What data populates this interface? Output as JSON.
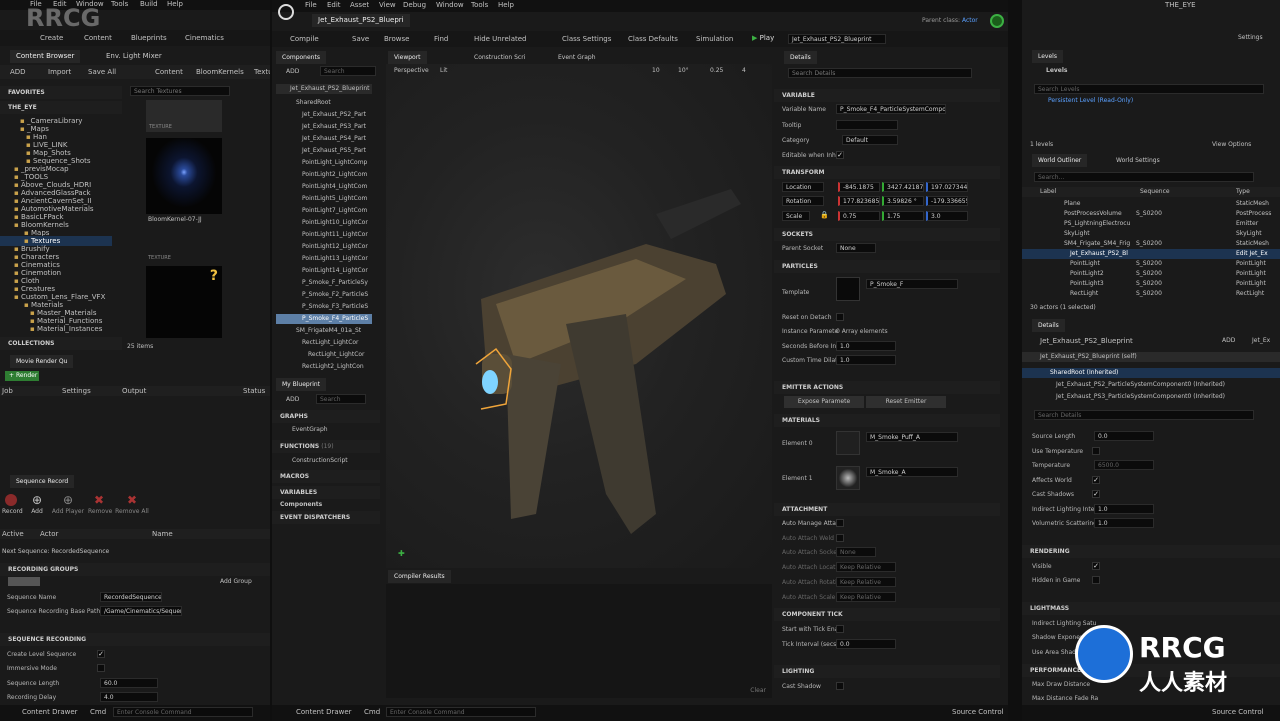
{
  "left": {
    "menu": [
      "File",
      "Edit",
      "Window",
      "Tools",
      "Build",
      "Help"
    ],
    "toolbar": [
      "Create",
      "Content",
      "Blueprints",
      "Cinematics"
    ],
    "tabs": [
      "Content Browser",
      "Env. Light Mixer"
    ],
    "cb_bar": {
      "add": "ADD",
      "import": "Import",
      "save_all": "Save All",
      "path": [
        "Content",
        "BloomKernels",
        "Textu"
      ]
    },
    "favorites": "FAVORITES",
    "project": "THE_EYE",
    "tree": [
      "_CameraLibrary",
      "_Maps",
      "Han",
      "LIVE_LINK",
      "Map_Shots",
      "Sequence_Shots",
      "_previsMocap",
      "_TOOLS",
      "Above_Clouds_HDRI",
      "AdvancedGlassPack",
      "AncientCavernSet_II",
      "AutomotiveMaterials",
      "BasicLFPack",
      "BloomKernels",
      "Maps",
      "Textures",
      "Brushify",
      "Characters",
      "Cinematics",
      "Cinemotion",
      "Cloth",
      "Creatures",
      "Custom_Lens_Flare_VFX",
      "Materials",
      "Master_Materials",
      "Material_Functions",
      "Material_Instances"
    ],
    "search_textures": "Search Textures",
    "asset_label1": "TEXTURE",
    "asset_name": "BloomKernel-07-JJ",
    "asset_label2": "TEXTURE",
    "question": "?",
    "collections": "COLLECTIONS",
    "items": "25 items",
    "mrq_tab": "Movie Render Qu",
    "render": "Render",
    "cols": [
      "Job",
      "Settings",
      "Output",
      "Status"
    ],
    "seq_tab": "Sequence Record",
    "seq_btns": [
      "Record",
      "Add",
      "Add Player",
      "Remove",
      "Remove All"
    ],
    "seq_cols": [
      "Active",
      "Actor",
      "Name"
    ],
    "next_seq": "Next Sequence: RecordedSequence",
    "recording_groups": "RECORDING GROUPS",
    "add_group": "Add Group",
    "seq_name_label": "Sequence Name",
    "seq_name": "RecordedSequence",
    "base_path_label": "Sequence Recording Base Path",
    "base_path": "/Game/Cinematics/Sequences",
    "seq_recording": "SEQUENCE RECORDING",
    "create_level": "Create Level Sequence",
    "immersive": "Immersive Mode",
    "seq_len_label": "Sequence Length",
    "seq_len": "60.0",
    "rec_delay_label": "Recording Delay",
    "rec_delay": "4.0",
    "drawer": "Content Drawer",
    "cmd": "Cmd",
    "console": "Enter Console Command"
  },
  "mid": {
    "menu": [
      "File",
      "Edit",
      "Asset",
      "View",
      "Debug",
      "Window",
      "Tools",
      "Help"
    ],
    "doc_tab": "Jet_Exhaust_PS2_Bluepri",
    "parent_label": "Parent class:",
    "parent": "Actor",
    "toolbar": [
      "Compile",
      "Save",
      "Browse",
      "Find",
      "Hide Unrelated",
      "Class Settings",
      "Class Defaults",
      "Simulation",
      "Play"
    ],
    "bp_select": "Jet_Exhaust_PS2_Blueprint",
    "components_tab": "Components",
    "add": "ADD",
    "search": "Search",
    "root_item": "Jet_Exhaust_PS2_Blueprint",
    "components": [
      "SharedRoot",
      "Jet_Exhaust_PS2_Part",
      "Jet_Exhaust_PS3_Part",
      "Jet_Exhaust_PS4_Part",
      "Jet_Exhaust_PS5_Part",
      "PointLight_LightComp",
      "PointLight2_LightCom",
      "PointLight4_LightCom",
      "PointLight5_LightCom",
      "PointLight7_LightCom",
      "PointLight10_LightCor",
      "PointLight11_LightCor",
      "PointLight12_LightCor",
      "PointLight13_LightCor",
      "PointLight14_LightCor",
      "P_Smoke_F_ParticleSy",
      "P_Smoke_F2_ParticleS",
      "P_Smoke_F3_ParticleS",
      "P_Smoke_F4_ParticleS",
      "SM_FrigateM4_01a_St",
      "RectLight_LightCor",
      "RectLight_LightCor",
      "RectLight2_LightCon"
    ],
    "mybp_tab": "My Blueprint",
    "graphs": "GRAPHS",
    "event_graph": "EventGraph",
    "functions": "FUNCTIONS",
    "functions_count": "(19)",
    "construction": "ConstructionScript",
    "macros": "MACROS",
    "variables": "VARIABLES",
    "components_cat": "Components",
    "dispatchers": "EVENT DISPATCHERS",
    "viewport_tabs": [
      "Viewport",
      "Construction Scri",
      "Event Graph"
    ],
    "perspective": "Perspective",
    "lit": "Lit",
    "vp_nums": [
      "10",
      "10°",
      "0.25",
      "4"
    ],
    "compiler": "Compiler Results",
    "clear": "Clear",
    "drawer": "Content Drawer",
    "cmd": "Cmd",
    "console": "Enter Console Command",
    "source": "Source Control"
  },
  "details": {
    "tab": "Details",
    "search": "Search Details",
    "variable": "VARIABLE",
    "var_name_label": "Variable Name",
    "var_name": "P_Smoke_F4_ParticleSystemComponent0",
    "tooltip_label": "Tooltip",
    "category_label": "Category",
    "category": "Default",
    "editable_label": "Editable when Inher",
    "transform": "TRANSFORM",
    "location": "Location",
    "loc": [
      "-845.1875",
      "3427.421875",
      "197.027344"
    ],
    "rotation": "Rotation",
    "rot": [
      "177.823685 °",
      "3.59826 °",
      "-179.336655"
    ],
    "scale": "Scale",
    "scl": [
      "0.75",
      "1.75",
      "3.0"
    ],
    "sockets": "SOCKETS",
    "parent_socket": "Parent Socket",
    "none": "None",
    "particles": "PARTICLES",
    "template_label": "Template",
    "template": "P_Smoke_F",
    "reset_detach": "Reset on Detach",
    "instance_params": "Instance Paramete",
    "array_elements": "0 Array elements",
    "seconds_before": "Seconds Before Inac",
    "seconds_val": "1.0",
    "custom_time": "Custom Time Dilatio",
    "custom_val": "1.0",
    "emitter_actions": "EMITTER ACTIONS",
    "expose": "Expose Paramete",
    "reset_emitter": "Reset Emitter",
    "materials": "MATERIALS",
    "element0": "Element 0",
    "mat0": "M_Smoke_Puff_A",
    "element1": "Element 1",
    "mat1": "M_Smoke_A",
    "attachment": "ATTACHMENT",
    "auto_manage": "Auto Manage Attach",
    "auto_world": "Auto Attach Weld Si",
    "auto_socket": "Auto Attach Socket",
    "auto_loc": "Auto Attach Locatio",
    "auto_rot": "Auto Attach Rotatio",
    "auto_scale": "Auto Attach Scale",
    "keep_rel": "Keep Relative",
    "component_tick": "COMPONENT TICK",
    "start_tick": "Start with Tick Enab",
    "tick_interval": "Tick Interval (secs)",
    "tick_val": "0.0",
    "lighting": "LIGHTING",
    "cast_shadow": "Cast Shadow"
  },
  "right": {
    "tab_levels": "Levels",
    "levels_btn": "Levels",
    "search_levels": "Search Levels",
    "persistent": "Persistent Level (Read-Only)",
    "levels_count": "1 levels",
    "view_options": "View Options",
    "outliner_tab": "World Outliner",
    "world_settings": "World Settings",
    "search": "Search...",
    "cols": [
      "Label",
      "Sequence",
      "Type"
    ],
    "rows": [
      {
        "label": "Plane",
        "seq": "",
        "type": "StaticMesh"
      },
      {
        "label": "PostProcessVolume",
        "seq": "S_S0200",
        "type": "PostProcess"
      },
      {
        "label": "PS_LightningElectrocu",
        "seq": "",
        "type": "Emitter"
      },
      {
        "label": "SkyLight",
        "seq": "",
        "type": "SkyLight"
      },
      {
        "label": "SM4_Frigate_SM4_Frig",
        "seq": "S_S0200",
        "type": "StaticMesh"
      },
      {
        "label": "Jet_Exhaust_PS2_Bl",
        "seq": "",
        "type": "Edit Jet_Ex"
      },
      {
        "label": "PointLight",
        "seq": "S_S0200",
        "type": "PointLight"
      },
      {
        "label": "PointLight2",
        "seq": "S_S0200",
        "type": "PointLight"
      },
      {
        "label": "PointLight3",
        "seq": "S_S0200",
        "type": "PointLight"
      },
      {
        "label": "RectLight",
        "seq": "S_S0200",
        "type": "RectLight"
      }
    ],
    "actors": "30 actors (1 selected)",
    "details_tab": "Details",
    "bp_name": "Jet_Exhaust_PS2_Blueprint",
    "add": "ADD",
    "jet_short": "Jet_Ex",
    "self": "Jet_Exhaust_PS2_Blueprint (self)",
    "shared": "SharedRoot (Inherited)",
    "comp1": "Jet_Exhaust_PS2_ParticleSystemComponent0 (Inherited)",
    "comp2": "Jet_Exhaust_PS3_ParticleSystemComponent0 (Inherited)",
    "search_details": "Search Details",
    "source_len": "Source Length",
    "source_val": "0.0",
    "use_temp": "Use Temperature",
    "temperature": "Temperature",
    "temp_val": "6500.0",
    "affects_world": "Affects World",
    "cast_shadows": "Cast Shadows",
    "indirect": "Indirect Lighting Inten",
    "indirect_val": "1.0",
    "volumetric": "Volumetric Scattering",
    "vol_val": "1.0",
    "rendering": "RENDERING",
    "visible": "Visible",
    "hidden_game": "Hidden in Game",
    "lightmass": "LIGHTMASS",
    "indirect_sat": "Indirect Lighting Satu",
    "shadow_exp": "Shadow Exponent",
    "use_area": "Use Area Shadows",
    "performance": "PERFORMANCE",
    "max_draw": "Max Draw Distance",
    "max_fade": "Max Distance Fade Ra",
    "settings": "Settings",
    "drawer_src": "Source Control",
    "title": "THE_EYE"
  },
  "watermark": {
    "rrcg": "RRCG",
    "cn": "人人素材"
  },
  "colors": {
    "accent": "#1d6fd8",
    "orange": "#f0a53a",
    "selected": "#1c3350",
    "green": "#3cb043"
  }
}
